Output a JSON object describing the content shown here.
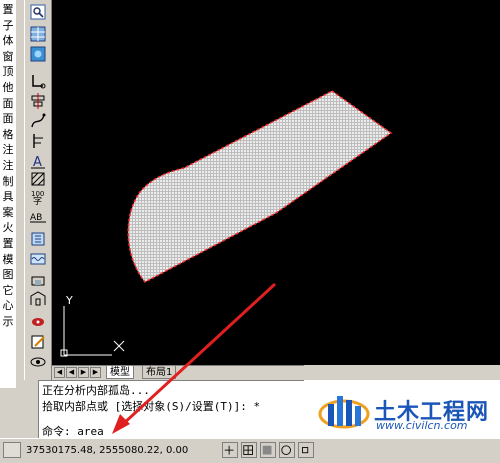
{
  "left_labels": [
    "置",
    "子",
    "体",
    "窗",
    "顶",
    "他",
    "面",
    "面",
    "格",
    "注",
    "注",
    "制",
    "具",
    "案",
    "火",
    "置",
    "模",
    "图",
    "它",
    "心",
    "示"
  ],
  "tabs": [
    {
      "label": "模型",
      "active": true
    },
    {
      "label": "布局1",
      "active": false
    }
  ],
  "command": {
    "lines": [
      "正在分析内部孤岛...",
      "拾取内部点或 [选择对象(S)/设置(T)]: *"
    ],
    "prompt": "命令: area"
  },
  "status": {
    "coordinates": "37530175.48, 2555080.22, 0.00"
  },
  "ucs": {
    "x_label": "X",
    "y_label": "Y"
  },
  "watermark": {
    "name": "土木工程网",
    "url": "www.civilcn.com"
  },
  "colors": {
    "canvas": "#000000",
    "boundary": "#ff2a2a",
    "hatch": "#d8d8d8",
    "annotation_arrow": "#e02020",
    "brand": "#1a56b8"
  }
}
